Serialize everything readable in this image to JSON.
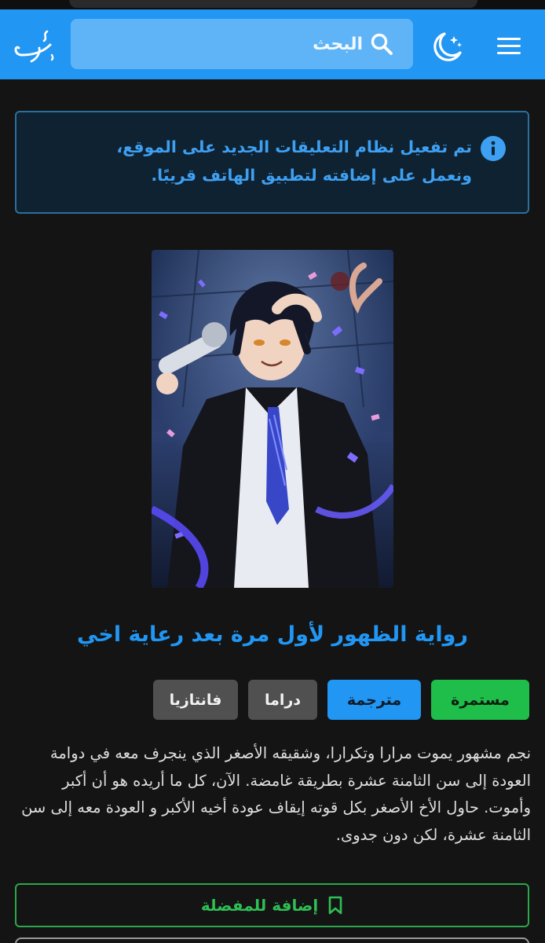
{
  "header": {
    "search": {
      "placeholder": "البحث"
    },
    "icons": {
      "menu": "hamburger-menu-icon",
      "theme": "moon-stars-icon",
      "search": "search-icon",
      "logo": "site-logo"
    },
    "accent_color": "#2196f3"
  },
  "notice": {
    "lines": [
      "تم تفعيل نظام التعليقات الجديد على الموقع،",
      "ونعمل على إضافته لتطبيق الهاتف قريبًا."
    ],
    "icon": "info-circle-icon"
  },
  "novel": {
    "title": "رواية الظهور لأول مرة بعد رعاية اخي",
    "status": "مستمرة",
    "translation": "مترجمة",
    "genres": [
      "دراما",
      "فانتازيا"
    ],
    "description": "نجم مشهور يموت مرارا وتكرارا، وشقيقه الأصغر الذي ينجرف معه في دوامة العودة إلى سن الثامنة عشرة بطريقة غامضة. الآن، كل ما أريده هو أن أكبر وأموت. حاول الأخ الأصغر بكل قوته إيقاف عودة أخيه الأكبر و العودة معه إلى سن الثامنة عشرة، لكن دون جدوى."
  },
  "actions": {
    "add_favorite": "إضافة للمفضلة",
    "favorite_icon": "bookmark-icon"
  },
  "colors": {
    "status": "#1fbe4a",
    "translated": "#2196f3",
    "genre": "#505050",
    "notice_text": "#3ea0f2",
    "favorite": "#2fbf54"
  }
}
